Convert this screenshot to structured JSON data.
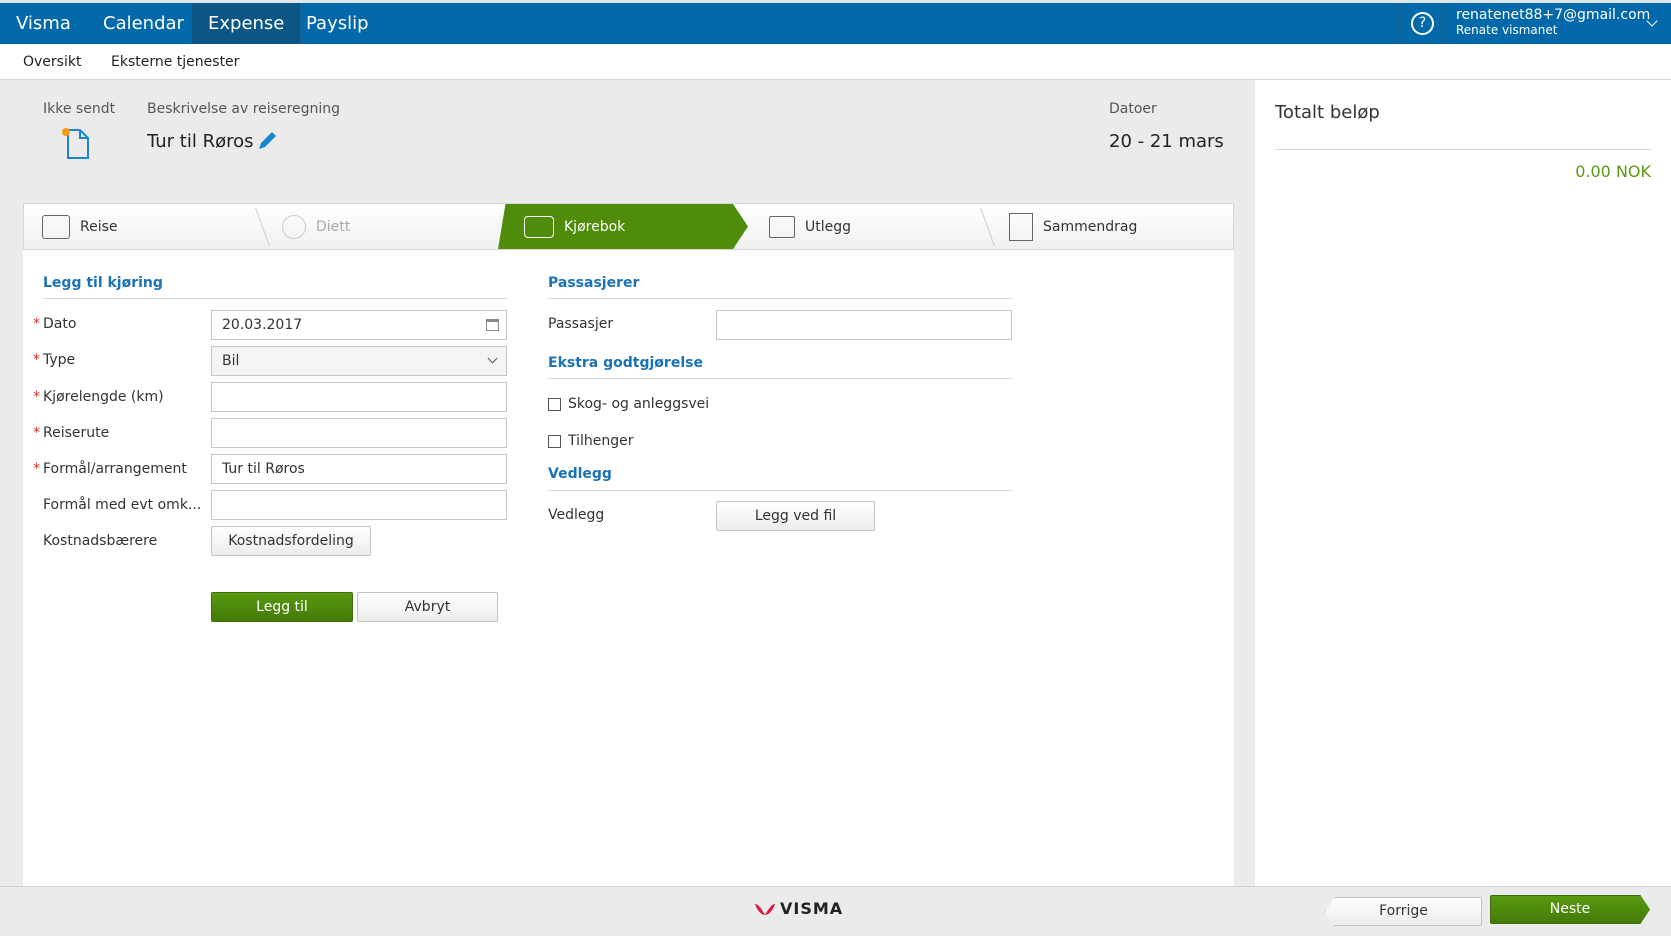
{
  "topbar": {
    "brand": "Visma",
    "nav": [
      "Calendar",
      "Expense",
      "Payslip"
    ],
    "email": "renatenet88+7@gmail.com",
    "user": "Renate vismanet"
  },
  "subnav": [
    "Oversikt",
    "Eksterne tjenester"
  ],
  "header": {
    "status": "Ikke sendt",
    "desc_label": "Beskrivelse av reiseregning",
    "title": "Tur til Røros",
    "dates_label": "Datoer",
    "dates": "20 - 21 mars"
  },
  "tabs": [
    "Reise",
    "Diett",
    "Kjørebok",
    "Utlegg",
    "Sammendrag"
  ],
  "form": {
    "title": "Legg til kjøring",
    "dato_label": "Dato",
    "dato": "20.03.2017",
    "type_label": "Type",
    "type": "Bil",
    "km_label": "Kjørelengde (km)",
    "rute_label": "Reiserute",
    "formal_label": "Formål/arrangement",
    "formal": "Tur til Røros",
    "formal2_label": "Formål med evt omk...",
    "kost_label": "Kostnadsbærere",
    "kost_button": "Kostnadsfordeling",
    "add": "Legg til",
    "cancel": "Avbryt"
  },
  "side": {
    "pass_title": "Passasjerer",
    "pass_label": "Passasjer",
    "extra_title": "Ekstra godtgjørelse",
    "cb1": "Skog- og anleggsvei",
    "cb2": "Tilhenger",
    "att_title": "Vedlegg",
    "att_label": "Vedlegg",
    "att_button": "Legg ved fil"
  },
  "total": {
    "label": "Totalt beløp",
    "value": "0.00 NOK"
  },
  "footer": {
    "logo": "VISMA",
    "prev": "Forrige",
    "next": "Neste"
  },
  "colors": {
    "brand": "#0169aa",
    "green": "#4f8c0a",
    "accent": "#1a72b8"
  }
}
